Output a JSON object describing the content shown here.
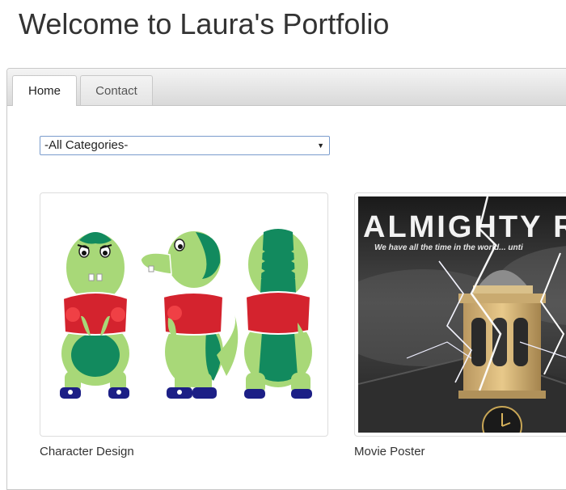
{
  "page": {
    "title": "Welcome to Laura's Portfolio"
  },
  "tabs": [
    {
      "label": "Home",
      "active": true
    },
    {
      "label": "Contact",
      "active": false
    }
  ],
  "filter": {
    "selected": "-All Categories-"
  },
  "portfolio": [
    {
      "caption": "Character Design",
      "image": "green-dinosaur-character-turnaround"
    },
    {
      "caption": "Movie Poster",
      "image": "almighty-movie-poster",
      "poster_title": "ALMIGHTY RAP",
      "poster_tagline": "We have all the time in the world... unti"
    }
  ],
  "colors": {
    "character_green": "#a8d878",
    "character_dark_green": "#128a5e",
    "shirt_red": "#d4232e",
    "shoe_navy": "#1c1f86"
  }
}
